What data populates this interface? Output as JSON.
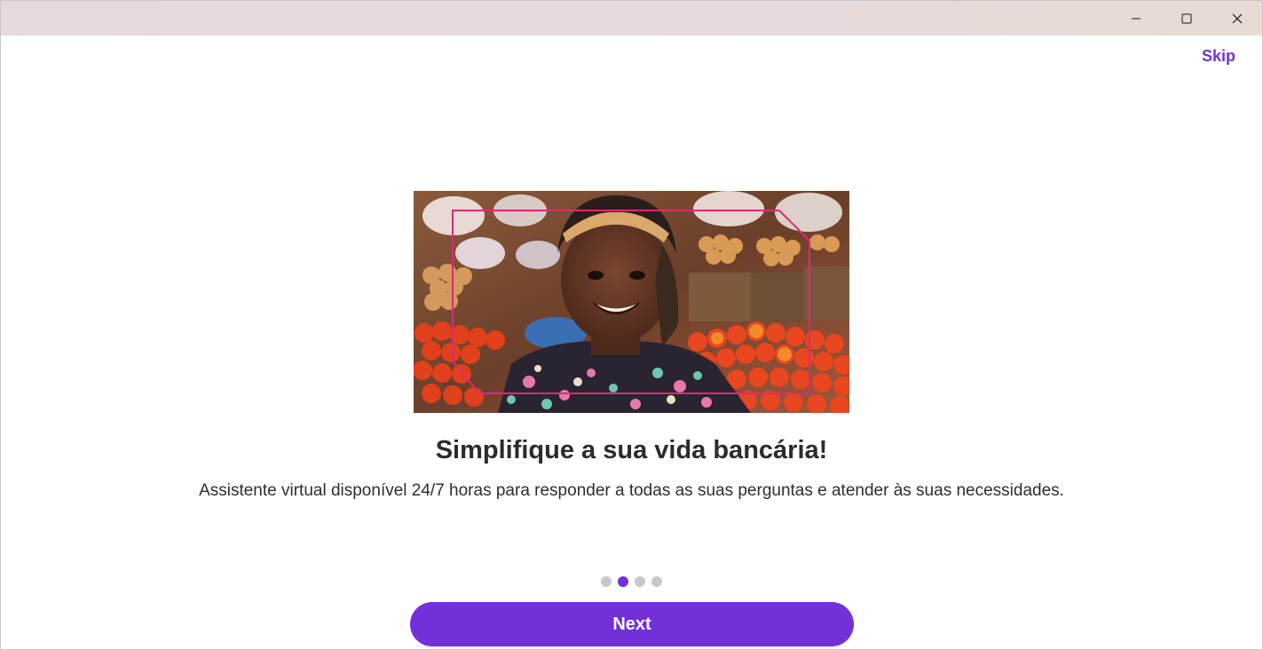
{
  "window": {
    "minimize_icon": "minimize-icon",
    "maximize_icon": "maximize-icon",
    "close_icon": "close-icon"
  },
  "header": {
    "skip_label": "Skip"
  },
  "hero": {
    "image": "photo of smiling woman at a market stall with tomatoes and onions, framed by a pink outline"
  },
  "content": {
    "title": "Simplifique a sua vida bancária!",
    "subtitle": "Assistente virtual disponível 24/7 horas para responder a todas as suas perguntas e atender às suas necessidades."
  },
  "pager": {
    "total": 4,
    "current": 2
  },
  "footer": {
    "next_label": "Next"
  },
  "colors": {
    "accent": "#7231d8",
    "dot_inactive": "#c9c6d0",
    "frame_pink": "#e0287a"
  }
}
